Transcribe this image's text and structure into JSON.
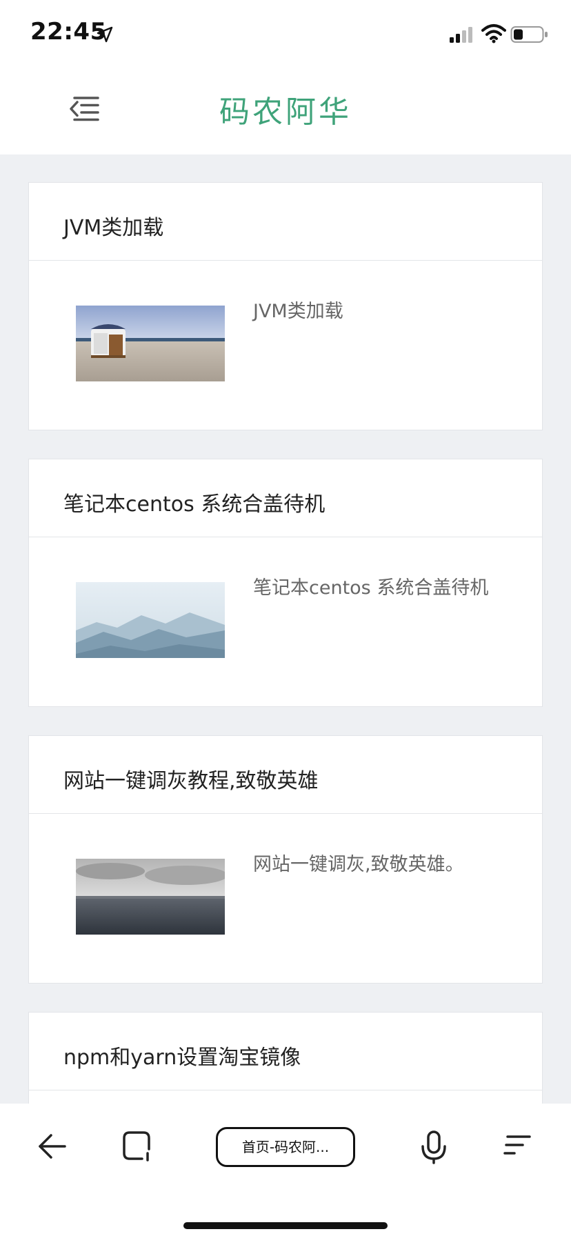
{
  "status_bar": {
    "time": "22:45",
    "icons": [
      "location-arrow-icon",
      "signal-icon",
      "wifi-icon",
      "battery-icon"
    ]
  },
  "header": {
    "title": "码农阿华",
    "menu_icon": "menu-collapse-icon",
    "title_color": "#3fa37a"
  },
  "posts": [
    {
      "title": "JVM类加载",
      "summary": "JVM类加载",
      "thumbnail": "beach-chair-image"
    },
    {
      "title": "笔记本centos 系统合盖待机",
      "summary": "笔记本centos 系统合盖待机",
      "thumbnail": "misty-mountains-image"
    },
    {
      "title": "网站一键调灰教程,致敬英雄",
      "summary": "网站一键调灰,致敬英雄。",
      "thumbnail": "grey-sea-image"
    },
    {
      "title": "npm和yarn设置淘宝镜像"
    }
  ],
  "toolbar": {
    "url_label": "首页-码农阿...",
    "icons": [
      "back-arrow-icon",
      "tabs-icon",
      "microphone-icon",
      "more-menu-icon"
    ]
  }
}
